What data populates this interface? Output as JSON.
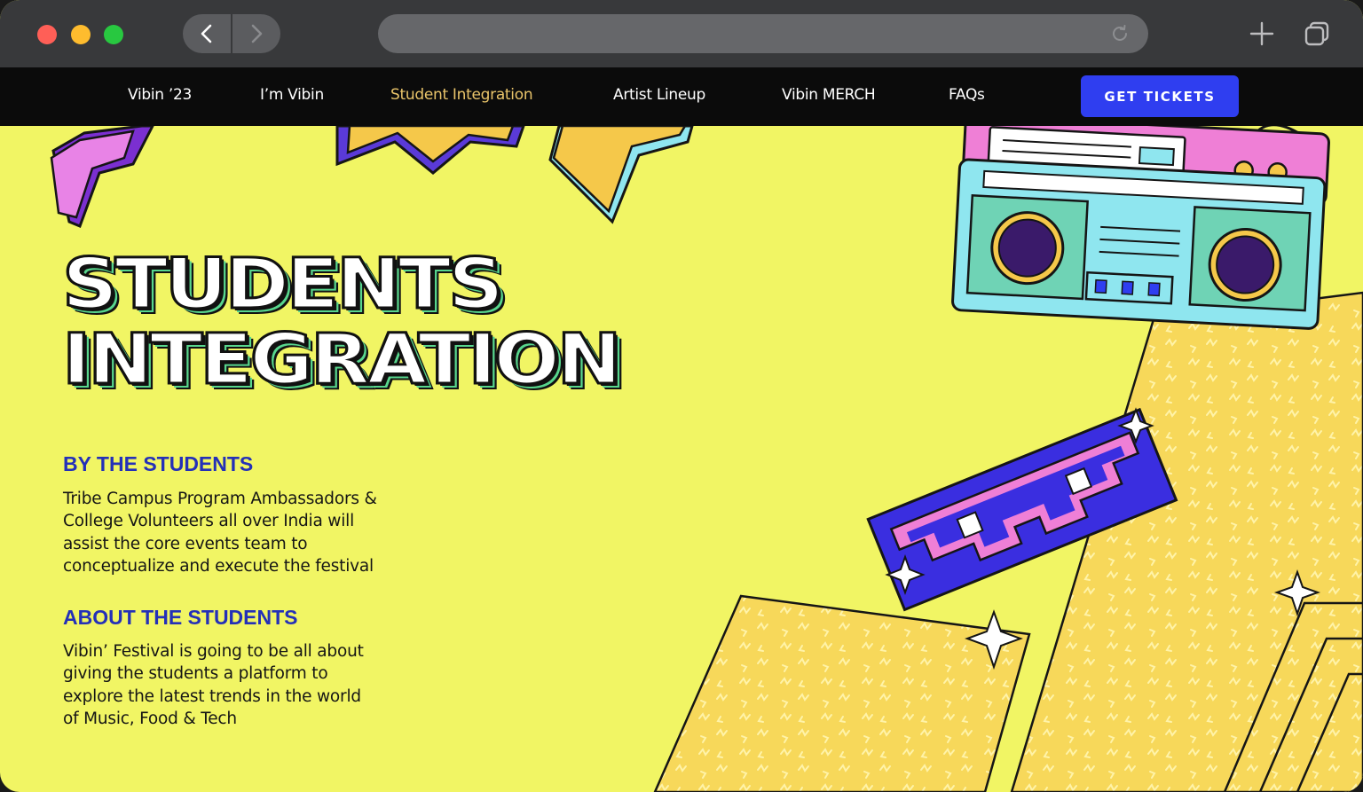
{
  "browser": {
    "back_icon": "chevron-left-icon",
    "forward_icon": "chevron-right-icon",
    "reload_icon": "reload-icon",
    "new_tab_icon": "plus-icon",
    "tabs_icon": "tabs-icon"
  },
  "nav": {
    "items": [
      {
        "label": "Vibin ’23"
      },
      {
        "label": "I’m Vibin"
      },
      {
        "label": "Student Integration",
        "active": true
      },
      {
        "label": "Artist Lineup"
      },
      {
        "label": "Vibin MERCH"
      },
      {
        "label": "FAQs"
      }
    ],
    "cta_label": "GET TICKETS"
  },
  "hero": {
    "title_line1": "STUDENTS",
    "title_line2": "INTEGRATION"
  },
  "sections": [
    {
      "heading": "BY THE STUDENTS",
      "lines": [
        "Tribe Campus Program Ambassadors &",
        "College Volunteers all over India will",
        "assist the core events team to",
        "conceptualize and execute the festival"
      ]
    },
    {
      "heading": "ABOUT THE STUDENTS",
      "lines": [
        "Vibin’ Festival is going to be all about",
        "giving the students a platform to",
        "explore the latest trends in the world",
        "of Music, Food & Tech"
      ]
    }
  ],
  "colors": {
    "background": "#f1f564",
    "nav_bg": "#0b0b0b",
    "active_link": "#e9c46a",
    "cta": "#2f3ef0",
    "heading": "#2430b8"
  }
}
